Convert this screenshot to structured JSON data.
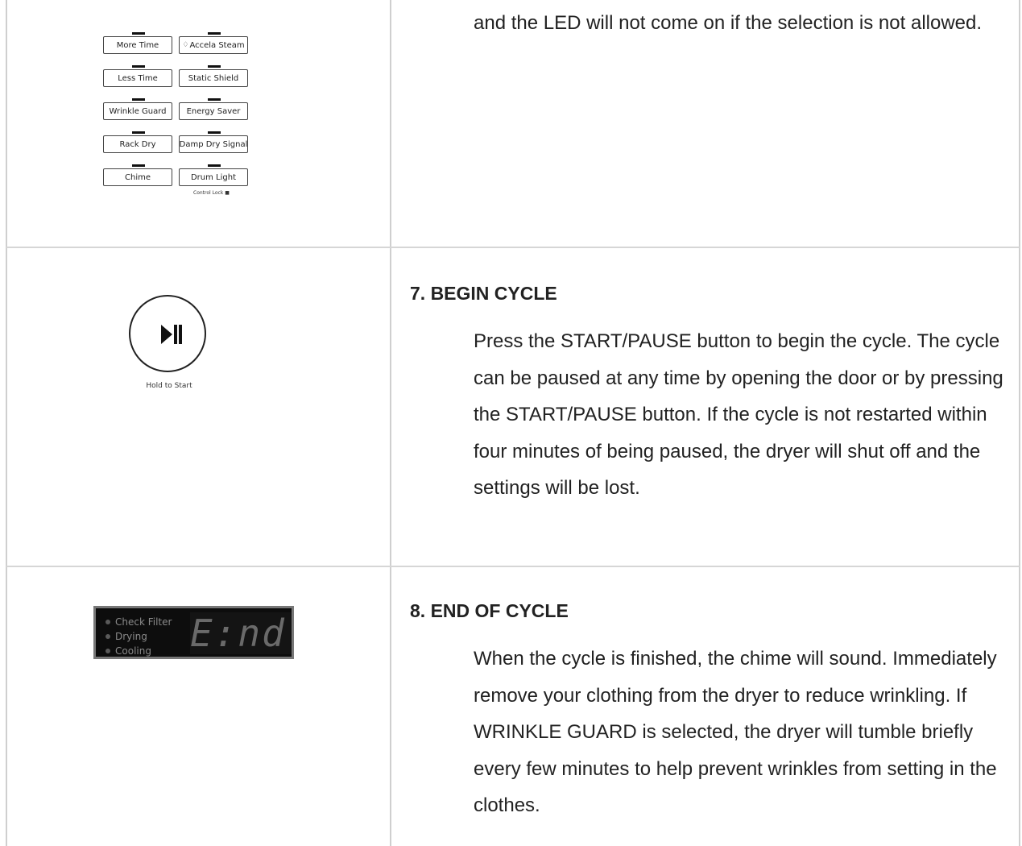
{
  "row1": {
    "options": [
      {
        "left": "More Time",
        "right": "Accela Steam"
      },
      {
        "left": "Less Time",
        "right": "Static Shield"
      },
      {
        "left": "Wrinkle Guard",
        "right": "Energy Saver"
      },
      {
        "left": "Rack Dry",
        "right": "Damp Dry Signal"
      },
      {
        "left": "Chime",
        "right": "Drum Light"
      }
    ],
    "control_lock_label": "Control Lock",
    "text": "and the LED will not come on if the selection is not allowed."
  },
  "row2": {
    "start_label": "Hold to Start",
    "heading": "7. BEGIN CYCLE",
    "text": "Press the START/PAUSE button to begin the cycle. The cycle can be paused at any time by opening the door or by pressing the START/PAUSE button. If the cycle is not restarted within four minutes of being paused, the dryer will shut off and the settings will be lost."
  },
  "row3": {
    "indicators": [
      "Check Filter",
      "Drying",
      "Cooling"
    ],
    "display_text": "E:nd",
    "heading": "8. END OF CYCLE",
    "text": "When the cycle is finished, the chime will sound. Immediately remove your clothing from the dryer to reduce wrinkling. If WRINKLE GUARD is selected, the dryer will tumble briefly every few minutes to help prevent wrinkles from setting in the clothes."
  },
  "colors": {
    "grid_line": "#d6d6d6",
    "text": "#222222",
    "display_bg": "#0d0d0d"
  }
}
